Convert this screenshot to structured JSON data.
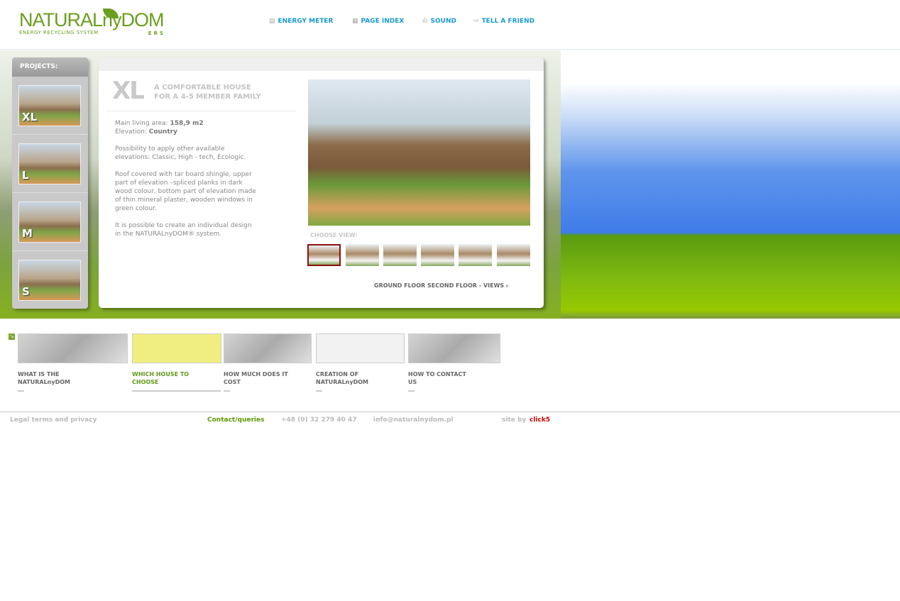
{
  "logo": {
    "name": "NATURALnyDOM",
    "tagline": "ENERGY RECYCLING SYSTEM",
    "ers": "ERS"
  },
  "topnav": [
    {
      "label": "ENERGY METER",
      "icon": "meter-icon"
    },
    {
      "label": "PAGE INDEX",
      "icon": "grid-icon"
    },
    {
      "label": "SOUND",
      "icon": "sound-icon"
    },
    {
      "label": "TELL A FRIEND",
      "icon": "share-icon"
    }
  ],
  "projects": {
    "title": "PROJECTS:",
    "items": [
      "XL",
      "L",
      "M",
      "S"
    ]
  },
  "house": {
    "code": "XL",
    "subtitle_1": "A COMFORTABLE HOUSE",
    "subtitle_2": "FOR A 4-5 MEMBER FAMILY",
    "area_label": "Main living area:",
    "area_value": "158,9 m2",
    "elevation_label": "Elevation:",
    "elevation_value": "Country",
    "p1": "Possibility to apply other available elevations: Classic, High - tech, Ecologic.",
    "p2": "Roof covered with tar board shingle, upper part of elevation –spliced planks in dark wood colour, bottom part of elevation made of thin mineral plaster, wooden windows in green colour.",
    "p3": "It is possible to create an individual design in the NATURALnyDOM® system."
  },
  "views": {
    "label": "CHOOSE VIEW:",
    "count": 6,
    "selected": 0
  },
  "floors": {
    "ground": "GROUND FLOOR",
    "second": "SECOND FLOOR",
    "sep": "-",
    "views": "VIEWS"
  },
  "infonav": [
    {
      "l1": "WHAT IS THE",
      "l2": "NATURALnyDOM"
    },
    {
      "l1": "WHICH HOUSE TO",
      "l2": "CHOOSE",
      "active": true
    },
    {
      "l1": "HOW MUCH DOES IT",
      "l2": "COST"
    },
    {
      "l1": "CREATION OF",
      "l2": "NATURALnyDOM"
    },
    {
      "l1": "HOW TO CONTACT",
      "l2": "US"
    }
  ],
  "footer": {
    "legal": "Legal terms and privacy",
    "contact": "Contact/queries",
    "phone": "+48 (0) 32 279 40 47",
    "email": "info@naturalnydom.pl",
    "siteby": "site by",
    "credit": "click5"
  },
  "colors": {
    "green": "#6a9e1f",
    "blue": "#1a9ad0",
    "credit": "#cc0000"
  }
}
